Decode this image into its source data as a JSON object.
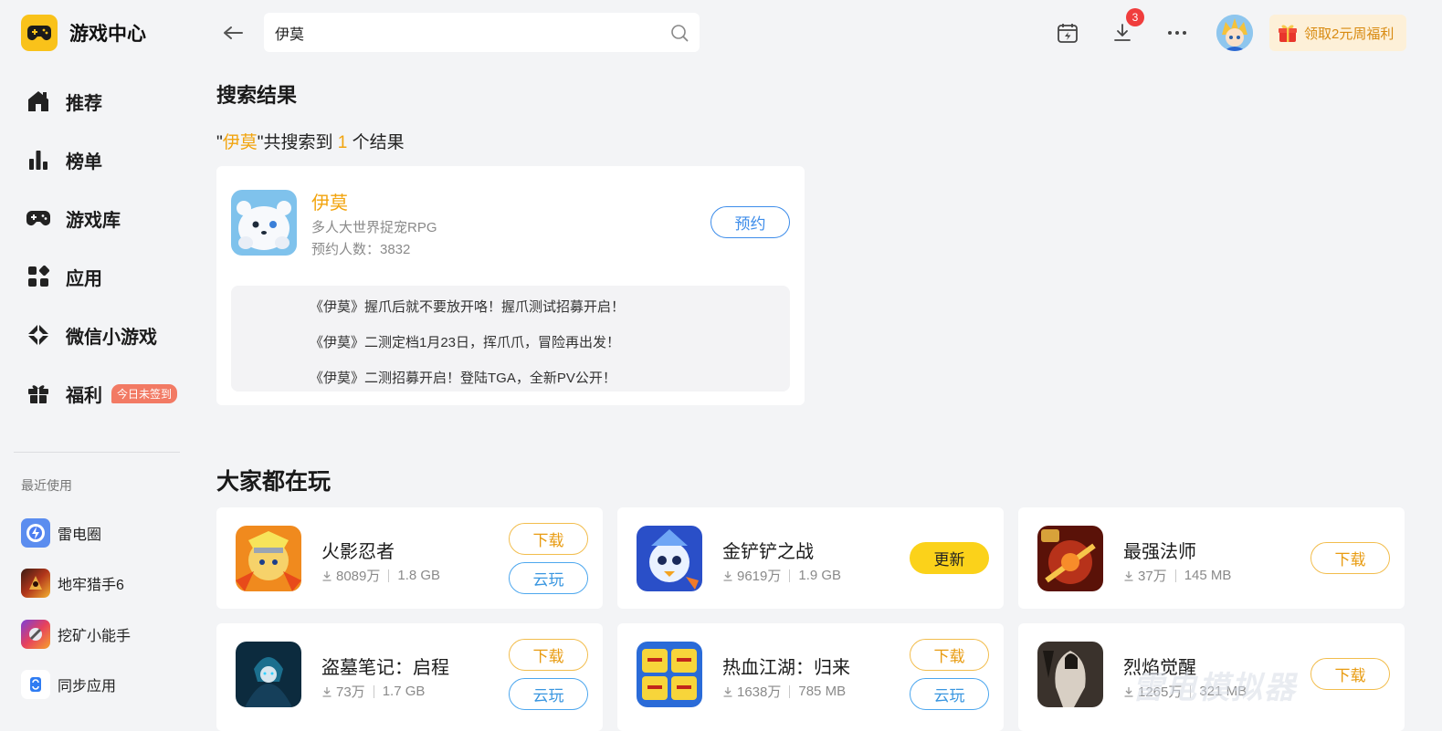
{
  "sidebar": {
    "brand_title": "游戏中心",
    "nav": [
      {
        "label": "推荐",
        "icon": "home-icon"
      },
      {
        "label": "榜单",
        "icon": "chart-bars-icon"
      },
      {
        "label": "游戏库",
        "icon": "gamepad-icon"
      },
      {
        "label": "应用",
        "icon": "apps-grid-icon"
      },
      {
        "label": "微信小游戏",
        "icon": "diamond-icon"
      },
      {
        "label": "福利",
        "icon": "gift-icon",
        "badge": "今日未签到"
      }
    ],
    "recent_title": "最近使用",
    "recent": [
      {
        "label": "雷电圈"
      },
      {
        "label": "地牢猎手6"
      },
      {
        "label": "挖矿小能手"
      },
      {
        "label": "同步应用"
      }
    ]
  },
  "topbar": {
    "search_value": "伊莫",
    "download_badge": "3",
    "promo_label": "领取2元周福利"
  },
  "results": {
    "section_title": "搜索结果",
    "quote_open": "\"",
    "keyword": "伊莫",
    "quote_close": "\"",
    "mid": "共搜索到 ",
    "count": "1",
    "suffix": " 个结果",
    "card": {
      "name": "伊莫",
      "genre": "多人大世界捉宠RPG",
      "reservations": "预约人数：3832",
      "button": "预约",
      "news": [
        "《伊莫》握爪后就不要放开咯！握爪测试招募开启！",
        "《伊莫》二测定档1月23日，挥爪爪，冒险再出发！",
        "《伊莫》二测招募开启！登陆TGA，全新PV公开！"
      ]
    }
  },
  "popular": {
    "section_title": "大家都在玩",
    "games": [
      {
        "name": "火影忍者",
        "downloads": "8089万",
        "size": "1.8 GB",
        "primary": "下载",
        "secondary": "云玩"
      },
      {
        "name": "金铲铲之战",
        "downloads": "9619万",
        "size": "1.9 GB",
        "primary": "更新"
      },
      {
        "name": "最强法师",
        "downloads": "37万",
        "size": "145 MB",
        "primary": "下载"
      },
      {
        "name": "盗墓笔记：启程",
        "downloads": "73万",
        "size": "1.7 GB",
        "primary": "下载",
        "secondary": "云玩"
      },
      {
        "name": "热血江湖：归来",
        "downloads": "1638万",
        "size": "785 MB",
        "primary": "下载",
        "secondary": "云玩"
      },
      {
        "name": "烈焰觉醒",
        "downloads": "1265万",
        "size": "321 MB",
        "primary": "下载"
      }
    ]
  },
  "watermark": "雷电模拟器",
  "colors": {
    "accent": "#f2a40e",
    "brand_yellow": "#f9c21a",
    "link_blue": "#3e8dea",
    "badge_red": "#f03d3d"
  }
}
